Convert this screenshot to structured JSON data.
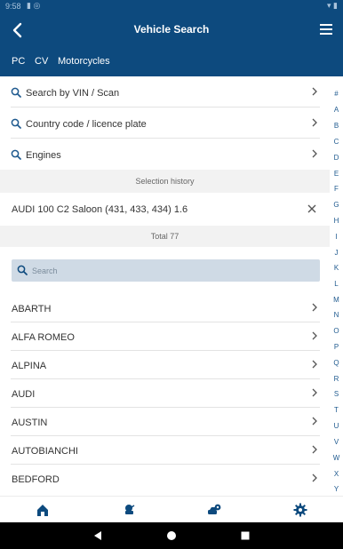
{
  "status_bar": {
    "time": "9:58"
  },
  "app_bar": {
    "title": "Vehicle Search"
  },
  "tabs": [
    {
      "label": "PC"
    },
    {
      "label": "CV"
    },
    {
      "label": "Motorcycles"
    }
  ],
  "search_options": [
    {
      "label": "Search by VIN / Scan",
      "icon": "search-icon"
    },
    {
      "label": "Country code / licence plate",
      "icon": "search-icon"
    },
    {
      "label": "Engines",
      "icon": "search-icon"
    }
  ],
  "selection_history": {
    "header": "Selection history",
    "items": [
      {
        "label": "AUDI 100 C2 Saloon (431, 433, 434) 1.6"
      }
    ]
  },
  "total": {
    "label": "Total 77"
  },
  "search": {
    "placeholder": "Search"
  },
  "makes": [
    {
      "label": "ABARTH"
    },
    {
      "label": "ALFA ROMEO"
    },
    {
      "label": "ALPINA"
    },
    {
      "label": "AUDI"
    },
    {
      "label": "AUSTIN"
    },
    {
      "label": "AUTOBIANCHI"
    },
    {
      "label": "BEDFORD"
    }
  ],
  "alphabet": [
    "#",
    "A",
    "B",
    "C",
    "D",
    "E",
    "F",
    "G",
    "H",
    "I",
    "J",
    "K",
    "L",
    "M",
    "N",
    "O",
    "P",
    "Q",
    "R",
    "S",
    "T",
    "U",
    "V",
    "W",
    "X",
    "Y"
  ],
  "bottom_nav": [
    {
      "icon": "home-icon",
      "active": true
    },
    {
      "icon": "oil-can-icon",
      "active": false
    },
    {
      "icon": "car-location-icon",
      "active": false
    },
    {
      "icon": "settings-gear-icon",
      "active": false
    }
  ],
  "colors": {
    "primary": "#0d4a7e",
    "accent_link": "#1f5a8f",
    "search_field": "#cfdae5",
    "band": "#f2f2f2"
  }
}
